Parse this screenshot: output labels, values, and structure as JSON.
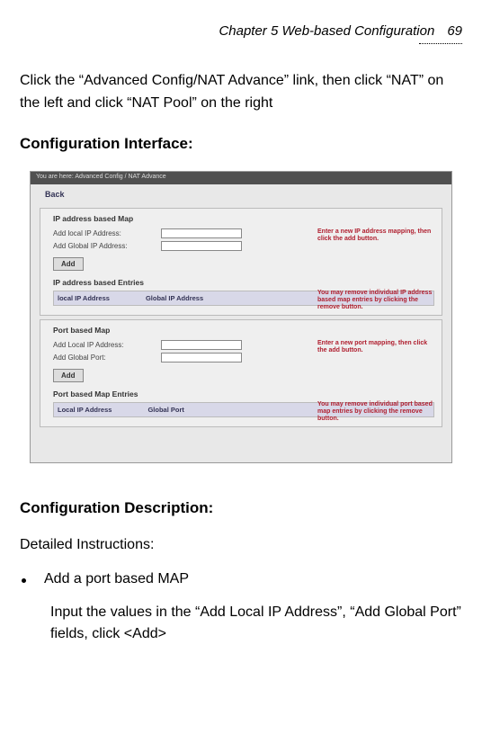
{
  "header": {
    "chapter_title": "Chapter 5 Web-based Configuration",
    "page_number": "69"
  },
  "intro": "Click the “Advanced Config/NAT Advance” link, then click “NAT” on the left and click “NAT Pool” on the right",
  "config_interface_heading": "Configuration Interface:",
  "screenshot": {
    "breadcrumb": "You are here: Advanced Config / NAT Advance",
    "back_link": "Back",
    "panel1": {
      "title": "IP address based Map",
      "row1_label": "Add local IP Address:",
      "row2_label": "Add Global IP Address:",
      "add_button": "Add",
      "note": "Enter a new IP address mapping, then click the add button.",
      "entries_title": "IP address based Entries",
      "col1": "local IP Address",
      "col2": "Global IP Address",
      "entries_note": "You may remove individual IP address based map entries by clicking the remove button."
    },
    "panel2": {
      "title": "Port based Map",
      "row1_label": "Add Local IP Address:",
      "row2_label": "Add Global Port:",
      "add_button": "Add",
      "note": "Enter a new port mapping, then click the add button.",
      "entries_title": "Port based Map Entries",
      "col1": "Local IP Address",
      "col2": "Global Port",
      "entries_note": "You may remove individual port based map entries by clicking the remove button."
    }
  },
  "config_desc_heading": "Configuration Description:",
  "detailed_instructions_label": "Detailed Instructions:",
  "bullet1": "Add a port based MAP",
  "bullet1_desc": "Input the values in the “Add Local IP Address”, “Add Global Port” fields, click <Add>"
}
